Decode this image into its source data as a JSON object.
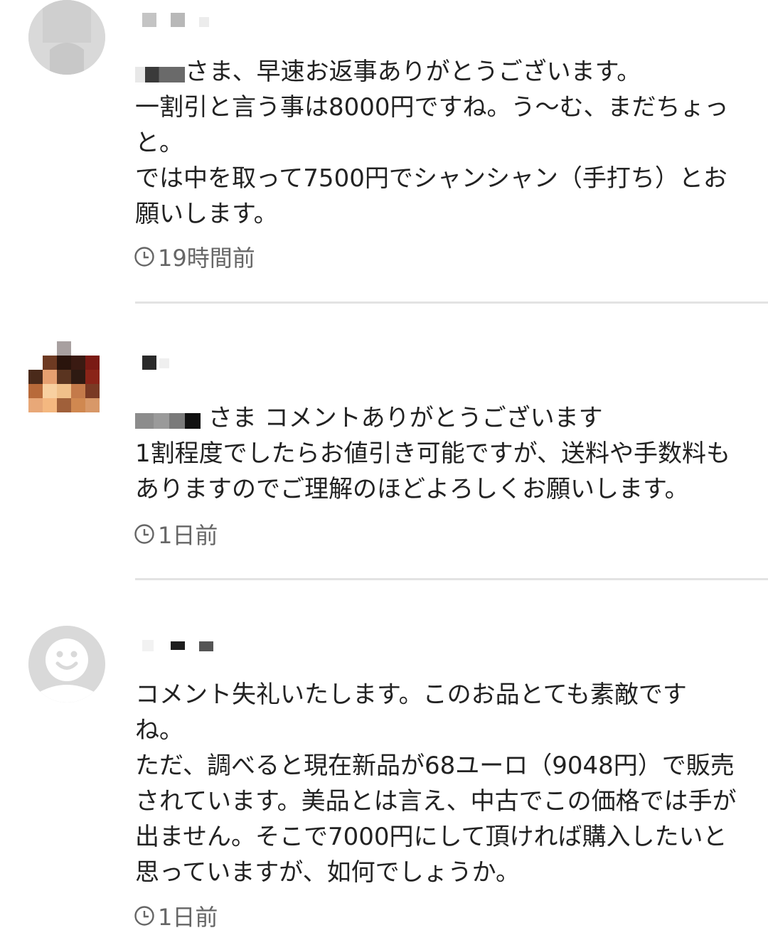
{
  "comments": [
    {
      "body_first_tail": "さま、早速お返事ありがとうございます。",
      "body_rest": "一割引と言う事は8000円ですね。う〜む、まだちょっ\nと。\nでは中を取って7500円でシャンシャン（手打ち）とお\n願いします。",
      "time": "19時間前"
    },
    {
      "body_first_tail": " さま コメントありがとうございます",
      "body_rest": "1割程度でしたらお値引き可能ですが、送料や手数料も\nありますのでご理解のほどよろしくお願いします。",
      "time": "1日前"
    },
    {
      "body_rest": "コメント失礼いたします。このお品とても素敵です\nね。\nただ、調べると現在新品が68ユーロ（9048円）で販売\nされています。美品とは言え、中古でこの価格では手が\n出ません。そこで7000円にして頂ければ購入したいと\n思っていますが、如何でしょうか。",
      "time": "1日前"
    }
  ],
  "icons": {
    "timestamp": "clock-icon",
    "default_avatar": "smiley-avatar-icon"
  },
  "colors": {
    "text": "#222222",
    "meta": "#666666",
    "divider": "#e3e3e3",
    "avatar_grey": "#d9d9d9"
  }
}
